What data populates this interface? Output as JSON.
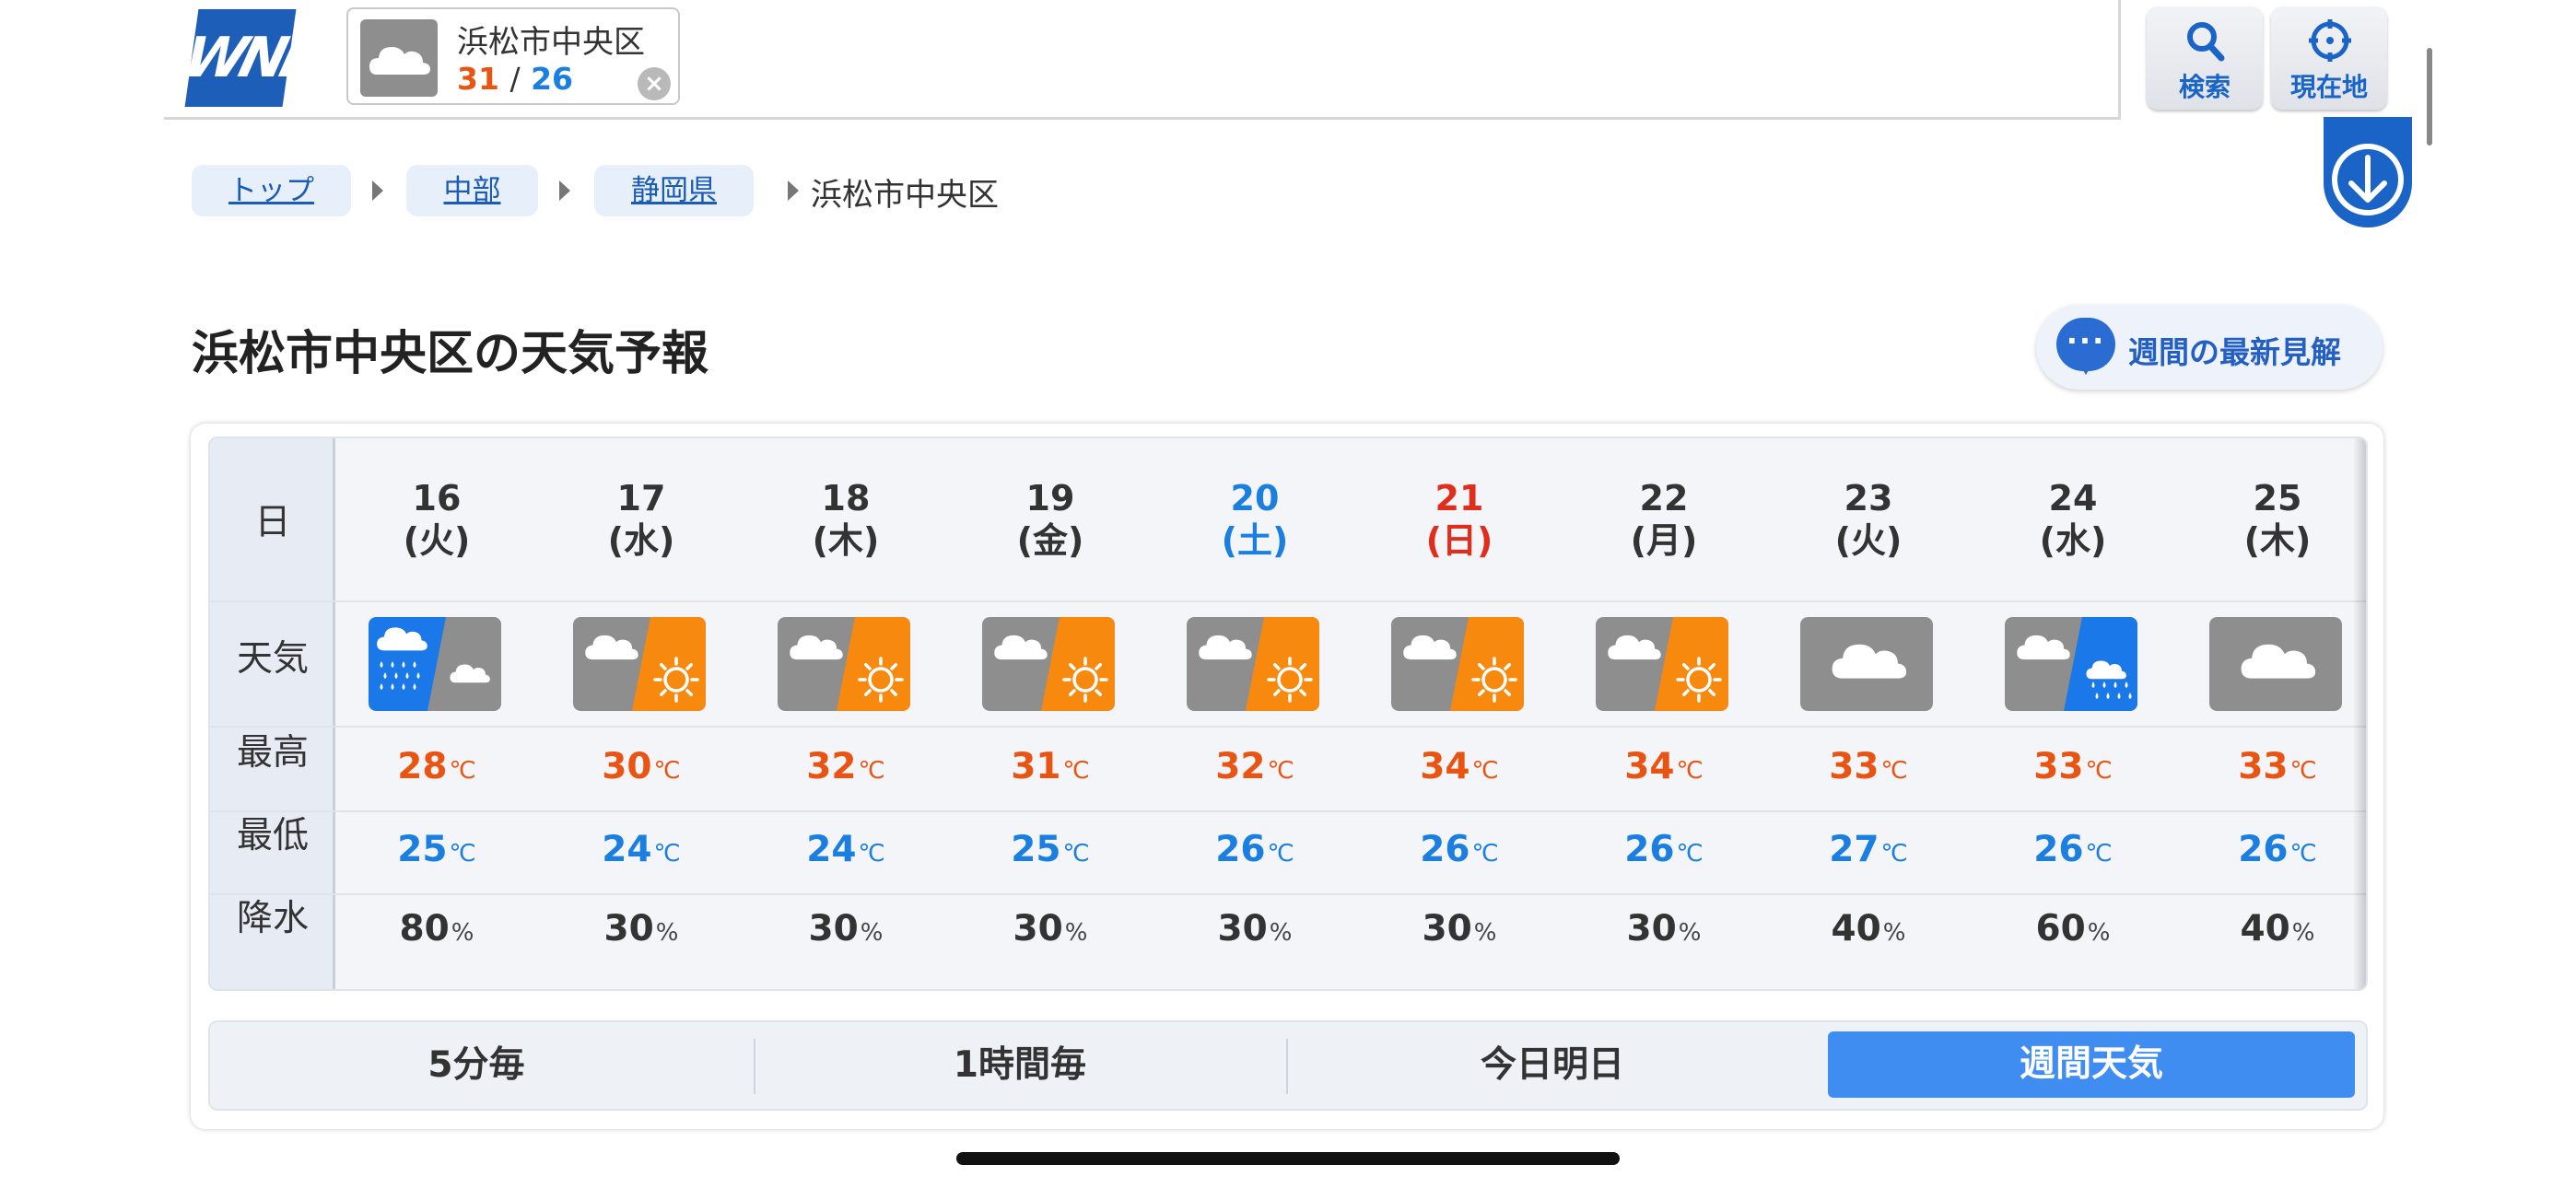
{
  "header": {
    "logo_text": "WNI",
    "location_card": {
      "name": "浜松市中央区",
      "high": "31",
      "separator": "/",
      "low": "26",
      "icon": "cloud-icon"
    },
    "search_label": "検索",
    "current_location_label": "現在地"
  },
  "breadcrumb": {
    "items": [
      "トップ",
      "中部",
      "静岡県"
    ],
    "current": "浜松市中央区"
  },
  "title": "浜松市中央区の天気予報",
  "latest_view_button": "週間の最新見解",
  "table": {
    "row_labels": [
      "日",
      "天気",
      "最高",
      "最低",
      "降水"
    ],
    "temp_unit": "℃",
    "rain_unit": "%",
    "days": [
      {
        "date": "16",
        "dow": "(火)",
        "kind": "weekday",
        "weather": "rain-then-cloudy",
        "high": "28",
        "low": "25",
        "rain": "80"
      },
      {
        "date": "17",
        "dow": "(水)",
        "kind": "weekday",
        "weather": "cloudy-then-sunny",
        "high": "30",
        "low": "24",
        "rain": "30"
      },
      {
        "date": "18",
        "dow": "(木)",
        "kind": "weekday",
        "weather": "cloudy-then-sunny",
        "high": "32",
        "low": "24",
        "rain": "30"
      },
      {
        "date": "19",
        "dow": "(金)",
        "kind": "weekday",
        "weather": "cloudy-then-sunny",
        "high": "31",
        "low": "25",
        "rain": "30"
      },
      {
        "date": "20",
        "dow": "(土)",
        "kind": "saturday",
        "weather": "cloudy-then-sunny",
        "high": "32",
        "low": "26",
        "rain": "30"
      },
      {
        "date": "21",
        "dow": "(日)",
        "kind": "sunday",
        "weather": "cloudy-then-sunny",
        "high": "34",
        "low": "26",
        "rain": "30"
      },
      {
        "date": "22",
        "dow": "(月)",
        "kind": "weekday",
        "weather": "cloudy-then-sunny",
        "high": "34",
        "low": "26",
        "rain": "30"
      },
      {
        "date": "23",
        "dow": "(火)",
        "kind": "weekday",
        "weather": "cloudy",
        "high": "33",
        "low": "27",
        "rain": "40"
      },
      {
        "date": "24",
        "dow": "(水)",
        "kind": "weekday",
        "weather": "cloudy-then-rain",
        "high": "33",
        "low": "26",
        "rain": "60"
      },
      {
        "date": "25",
        "dow": "(木)",
        "kind": "weekday",
        "weather": "cloudy",
        "high": "33",
        "low": "26",
        "rain": "40"
      }
    ]
  },
  "tabs": [
    {
      "label": "5分毎",
      "active": false
    },
    {
      "label": "1時間毎",
      "active": false
    },
    {
      "label": "今日明日",
      "active": false
    },
    {
      "label": "週間天気",
      "active": true
    }
  ],
  "colors": {
    "high": "#ea5413",
    "low": "#1a7fe0",
    "saturday": "#1a7fe0",
    "sunday": "#e02d1c",
    "accent": "#3f8df0",
    "sunny": "#f7890e",
    "rain": "#1a78e8",
    "cloudy": "#8e8e8e"
  }
}
